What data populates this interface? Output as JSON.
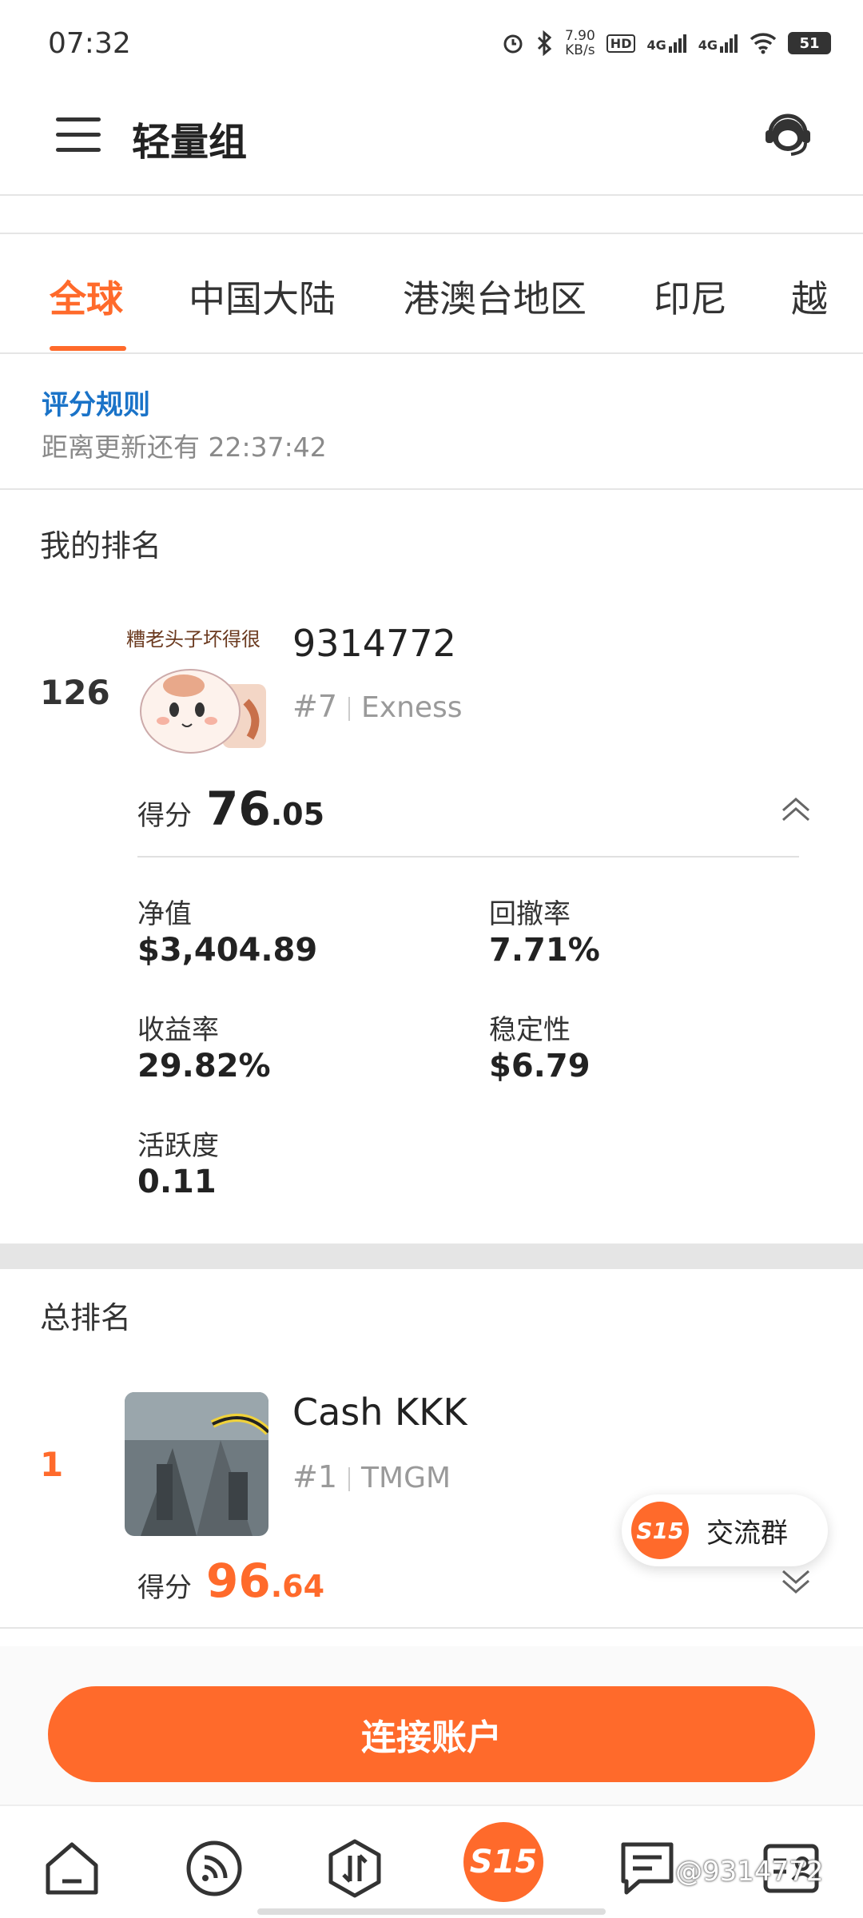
{
  "status_bar": {
    "time": "07:32",
    "net_speed_value": "7.90",
    "net_speed_unit": "KB/s",
    "signal_1": "4G",
    "signal_2": "4G",
    "hd_label": "HD",
    "battery": "51"
  },
  "header": {
    "title": "轻量组"
  },
  "tabs": [
    {
      "label": "全球",
      "active": true
    },
    {
      "label": "中国大陆",
      "active": false
    },
    {
      "label": "港澳台地区",
      "active": false
    },
    {
      "label": "印尼",
      "active": false
    },
    {
      "label": "越",
      "active": false
    }
  ],
  "rules": {
    "link": "评分规则",
    "countdown_prefix": "距离更新还有",
    "countdown_time": "22:37:42"
  },
  "my_ranking": {
    "section_title": "我的排名",
    "rank": "126",
    "avatar_caption": "糟老头子坏得很",
    "name": "9314772",
    "sub_rank": "#7",
    "broker": "Exness",
    "score_label": "得分",
    "score_int": "76",
    "score_dec": ".05",
    "stats": [
      {
        "label": "净值",
        "value": "$3,404.89"
      },
      {
        "label": "回撤率",
        "value": "7.71%"
      },
      {
        "label": "收益率",
        "value": "29.82%"
      },
      {
        "label": "稳定性",
        "value": "$6.79"
      },
      {
        "label": "活跃度",
        "value": "0.11"
      }
    ]
  },
  "overall_ranking": {
    "section_title": "总排名",
    "items": [
      {
        "rank": "1",
        "name": "Cash KKK",
        "sub_rank": "#1",
        "broker": "TMGM",
        "score_label": "得分",
        "score_int": "96",
        "score_dec": ".64"
      }
    ]
  },
  "float_chat": {
    "badge": "S15",
    "label": "交流群"
  },
  "connect_button": "连接账户",
  "bottom_nav": {
    "center_badge": "S15",
    "watermark": "@9314772"
  },
  "colors": {
    "accent": "#ff6a2b",
    "link": "#1a73c8"
  }
}
